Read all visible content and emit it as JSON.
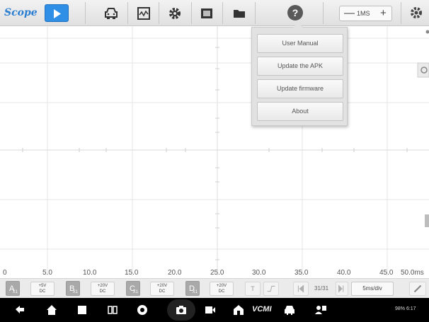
{
  "app": {
    "title": "Scope"
  },
  "toolbar": {
    "memory_label": "1MS",
    "minus_symbol": "—",
    "plus_symbol": "+",
    "icons": [
      "play-icon",
      "car-icon",
      "waveform-library-icon",
      "gear-icon",
      "screen-icon",
      "folder-icon",
      "help-icon",
      "settings-icon"
    ],
    "help_symbol": "?"
  },
  "help_menu": {
    "items": [
      {
        "label": "User Manual"
      },
      {
        "label": "Update the APK"
      },
      {
        "label": "Update firmware"
      },
      {
        "label": "About"
      }
    ]
  },
  "x_axis": {
    "tick_labels": [
      "0",
      "5.0",
      "10.0",
      "15.0",
      "20.0",
      "25.0",
      "30.0",
      "35.0",
      "40.0",
      "45.0",
      "50.0ms"
    ]
  },
  "channels": [
    {
      "letter": "A",
      "sub": "X1",
      "range": "+5V",
      "coupling": "DC",
      "color": "#a9a9a9"
    },
    {
      "letter": "B",
      "sub": "X1",
      "range": "+20V",
      "coupling": "DC",
      "color": "#a9a9a9"
    },
    {
      "letter": "C",
      "sub": "X1",
      "range": "+20V",
      "coupling": "DC",
      "color": "#a9a9a9"
    },
    {
      "letter": "D",
      "sub": "X1",
      "range": "+20V",
      "coupling": "DC",
      "color": "#a9a9a9"
    }
  ],
  "bottom_controls": {
    "trigger_label": "T",
    "page": "31/31",
    "timebase": "5ms/div"
  },
  "navbar": {
    "vcm_label": "VCMI",
    "status": "98% 6:17",
    "icons": [
      "back-icon",
      "home-icon",
      "recent-apps-icon",
      "multi-window-icon",
      "browser-icon",
      "camera-icon",
      "screen-record-icon",
      "store-icon",
      "vcm-icon",
      "car-icon",
      "remote-icon"
    ]
  },
  "colors": {
    "accent": "#2f8fe6",
    "nav_background": "#000000",
    "grid": "#e4e4e4"
  }
}
